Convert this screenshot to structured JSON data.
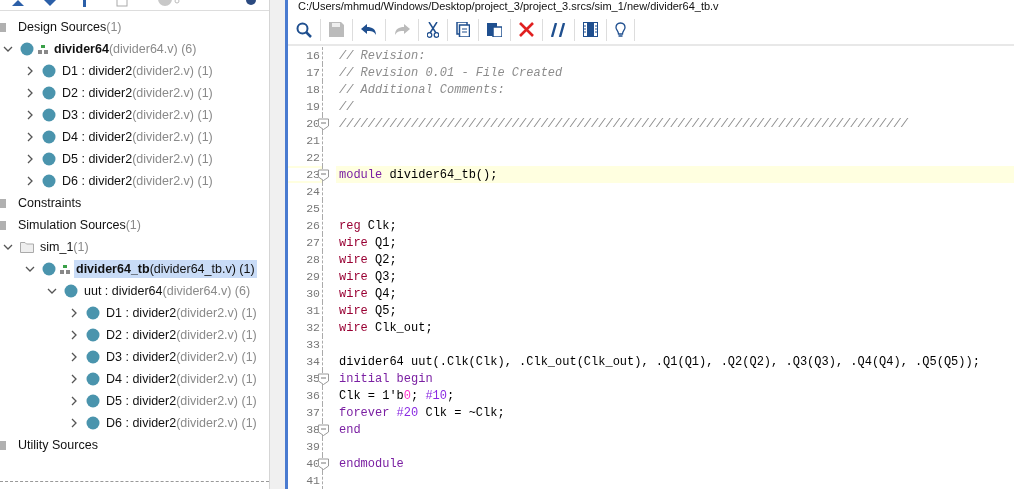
{
  "sources_tree": [
    {
      "kind": "folder",
      "name": "Design Sources",
      "detail": "(1)",
      "bold": false,
      "selected": false,
      "children": [
        {
          "kind": "module",
          "top": true,
          "name": "divider64",
          "detail": "(divider64.v) (6)",
          "bold": true,
          "selected": false,
          "expanded": true,
          "children": [
            {
              "kind": "module",
              "top": false,
              "name": "D1 : divider2",
              "detail": "(divider2.v) (1)",
              "bold": false,
              "selected": false,
              "expanded": false
            },
            {
              "kind": "module",
              "top": false,
              "name": "D2 : divider2",
              "detail": "(divider2.v) (1)",
              "bold": false,
              "selected": false,
              "expanded": false
            },
            {
              "kind": "module",
              "top": false,
              "name": "D3 : divider2",
              "detail": "(divider2.v) (1)",
              "bold": false,
              "selected": false,
              "expanded": false
            },
            {
              "kind": "module",
              "top": false,
              "name": "D4 : divider2",
              "detail": "(divider2.v) (1)",
              "bold": false,
              "selected": false,
              "expanded": false
            },
            {
              "kind": "module",
              "top": false,
              "name": "D5 : divider2",
              "detail": "(divider2.v) (1)",
              "bold": false,
              "selected": false,
              "expanded": false
            },
            {
              "kind": "module",
              "top": false,
              "name": "D6 : divider2",
              "detail": "(divider2.v) (1)",
              "bold": false,
              "selected": false,
              "expanded": false
            }
          ]
        }
      ]
    },
    {
      "kind": "folder",
      "name": "Constraints",
      "bold": false,
      "selected": false
    },
    {
      "kind": "folder",
      "name": "Simulation Sources",
      "detail": "(1)",
      "bold": false,
      "selected": false,
      "children": [
        {
          "kind": "fileset",
          "name": "sim_1",
          "detail": "(1)",
          "bold": false,
          "selected": false,
          "expanded": true,
          "children": [
            {
              "kind": "module",
              "top": true,
              "name": "divider64_tb",
              "detail": "(divider64_tb.v) (1)",
              "bold": true,
              "selected": true,
              "expanded": true,
              "children": [
                {
                  "kind": "module",
                  "top": false,
                  "name": "uut : divider64",
                  "detail": "(divider64.v) (6)",
                  "bold": false,
                  "selected": false,
                  "expanded": true,
                  "children": [
                    {
                      "kind": "module",
                      "top": false,
                      "name": "D1 : divider2",
                      "detail": "(divider2.v) (1)",
                      "bold": false,
                      "selected": false,
                      "expanded": false
                    },
                    {
                      "kind": "module",
                      "top": false,
                      "name": "D2 : divider2",
                      "detail": "(divider2.v) (1)",
                      "bold": false,
                      "selected": false,
                      "expanded": false
                    },
                    {
                      "kind": "module",
                      "top": false,
                      "name": "D3 : divider2",
                      "detail": "(divider2.v) (1)",
                      "bold": false,
                      "selected": false,
                      "expanded": false
                    },
                    {
                      "kind": "module",
                      "top": false,
                      "name": "D4 : divider2",
                      "detail": "(divider2.v) (1)",
                      "bold": false,
                      "selected": false,
                      "expanded": false
                    },
                    {
                      "kind": "module",
                      "top": false,
                      "name": "D5 : divider2",
                      "detail": "(divider2.v) (1)",
                      "bold": false,
                      "selected": false,
                      "expanded": false
                    },
                    {
                      "kind": "module",
                      "top": false,
                      "name": "D6 : divider2",
                      "detail": "(divider2.v) (1)",
                      "bold": false,
                      "selected": false,
                      "expanded": false
                    }
                  ]
                }
              ]
            }
          ]
        }
      ]
    },
    {
      "kind": "folder",
      "name": "Utility Sources",
      "bold": false,
      "selected": false
    }
  ],
  "editor": {
    "file_path": "C:/Users/mhmud/Windows/Desktop/project_3/project_3.srcs/sim_1/new/divider64_tb.v",
    "toolbar": [
      {
        "kind": "search",
        "disabled": false
      },
      {
        "kind": "save",
        "disabled": true
      },
      {
        "kind": "undo",
        "disabled": false
      },
      {
        "kind": "redo",
        "disabled": true
      },
      {
        "kind": "cut",
        "disabled": false
      },
      {
        "kind": "copy",
        "disabled": false
      },
      {
        "kind": "paste",
        "disabled": false
      },
      {
        "kind": "delete",
        "disabled": false
      },
      {
        "kind": "comment",
        "disabled": false
      },
      {
        "kind": "columns",
        "disabled": false
      },
      {
        "kind": "hint",
        "disabled": false
      }
    ],
    "lines": [
      {
        "number": "16",
        "fold": false,
        "current": false,
        "tokens": [
          {
            "kind": "comment",
            "t": "// Revision:"
          }
        ]
      },
      {
        "number": "17",
        "fold": false,
        "current": false,
        "tokens": [
          {
            "kind": "comment",
            "t": "// Revision 0.01 - File Created"
          }
        ]
      },
      {
        "number": "18",
        "fold": false,
        "current": false,
        "tokens": [
          {
            "kind": "comment",
            "t": "// Additional Comments:"
          }
        ]
      },
      {
        "number": "19",
        "fold": false,
        "current": false,
        "tokens": [
          {
            "kind": "comment",
            "t": "//"
          }
        ]
      },
      {
        "number": "20",
        "fold": true,
        "current": false,
        "tokens": [
          {
            "kind": "comment",
            "t": "///////////////////////////////////////////////////////////////////////////////"
          }
        ]
      },
      {
        "number": "21",
        "fold": false,
        "current": false
      },
      {
        "number": "22",
        "fold": false,
        "current": false
      },
      {
        "number": "23",
        "fold": true,
        "current": true,
        "tokens": [
          {
            "kind": "kw2",
            "t": "module"
          },
          {
            "kind": "plain",
            "t": " divider64_tb();"
          }
        ]
      },
      {
        "number": "24",
        "fold": false,
        "current": false
      },
      {
        "number": "25",
        "fold": false,
        "current": false
      },
      {
        "number": "26",
        "fold": false,
        "current": false,
        "tokens": [
          {
            "kind": "kw",
            "t": "reg"
          },
          {
            "kind": "plain",
            "t": " Clk;"
          }
        ]
      },
      {
        "number": "27",
        "fold": false,
        "current": false,
        "tokens": [
          {
            "kind": "kw",
            "t": "wire"
          },
          {
            "kind": "plain",
            "t": " Q1;"
          }
        ]
      },
      {
        "number": "28",
        "fold": false,
        "current": false,
        "tokens": [
          {
            "kind": "kw",
            "t": "wire"
          },
          {
            "kind": "plain",
            "t": " Q2;"
          }
        ]
      },
      {
        "number": "29",
        "fold": false,
        "current": false,
        "tokens": [
          {
            "kind": "kw",
            "t": "wire"
          },
          {
            "kind": "plain",
            "t": " Q3;"
          }
        ]
      },
      {
        "number": "30",
        "fold": false,
        "current": false,
        "tokens": [
          {
            "kind": "kw",
            "t": "wire"
          },
          {
            "kind": "plain",
            "t": " Q4;"
          }
        ]
      },
      {
        "number": "31",
        "fold": false,
        "current": false,
        "tokens": [
          {
            "kind": "kw",
            "t": "wire"
          },
          {
            "kind": "plain",
            "t": " Q5;"
          }
        ]
      },
      {
        "number": "32",
        "fold": false,
        "current": false,
        "tokens": [
          {
            "kind": "kw",
            "t": "wire"
          },
          {
            "kind": "plain",
            "t": " Clk_out;"
          }
        ]
      },
      {
        "number": "33",
        "fold": false,
        "current": false
      },
      {
        "number": "34",
        "fold": false,
        "current": false,
        "tokens": [
          {
            "kind": "plain",
            "t": "divider64 uut(.Clk(Clk), .Clk_out(Clk_out), .Q1(Q1), .Q2(Q2), .Q3(Q3), .Q4(Q4), .Q5(Q5));"
          }
        ]
      },
      {
        "number": "35",
        "fold": true,
        "current": false,
        "tokens": [
          {
            "kind": "kw2",
            "t": "initial begin"
          }
        ]
      },
      {
        "number": "36",
        "fold": false,
        "current": false,
        "tokens": [
          {
            "kind": "plain",
            "t": "Clk = 1'b"
          },
          {
            "kind": "num",
            "t": "0"
          },
          {
            "kind": "plain",
            "t": "; "
          },
          {
            "kind": "delay",
            "t": "#10"
          },
          {
            "kind": "plain",
            "t": ";"
          }
        ]
      },
      {
        "number": "37",
        "fold": false,
        "current": false,
        "tokens": [
          {
            "kind": "kw2",
            "t": "forever"
          },
          {
            "kind": "delay",
            "t": " #20"
          },
          {
            "kind": "plain",
            "t": " Clk = ~Clk;"
          }
        ]
      },
      {
        "number": "38",
        "fold": true,
        "current": false,
        "tokens": [
          {
            "kind": "kw2",
            "t": "end"
          }
        ]
      },
      {
        "number": "39",
        "fold": false,
        "current": false
      },
      {
        "number": "40",
        "fold": true,
        "current": false,
        "tokens": [
          {
            "kind": "kw2",
            "t": "endmodule"
          }
        ]
      },
      {
        "number": "41",
        "fold": false,
        "current": false
      }
    ]
  }
}
